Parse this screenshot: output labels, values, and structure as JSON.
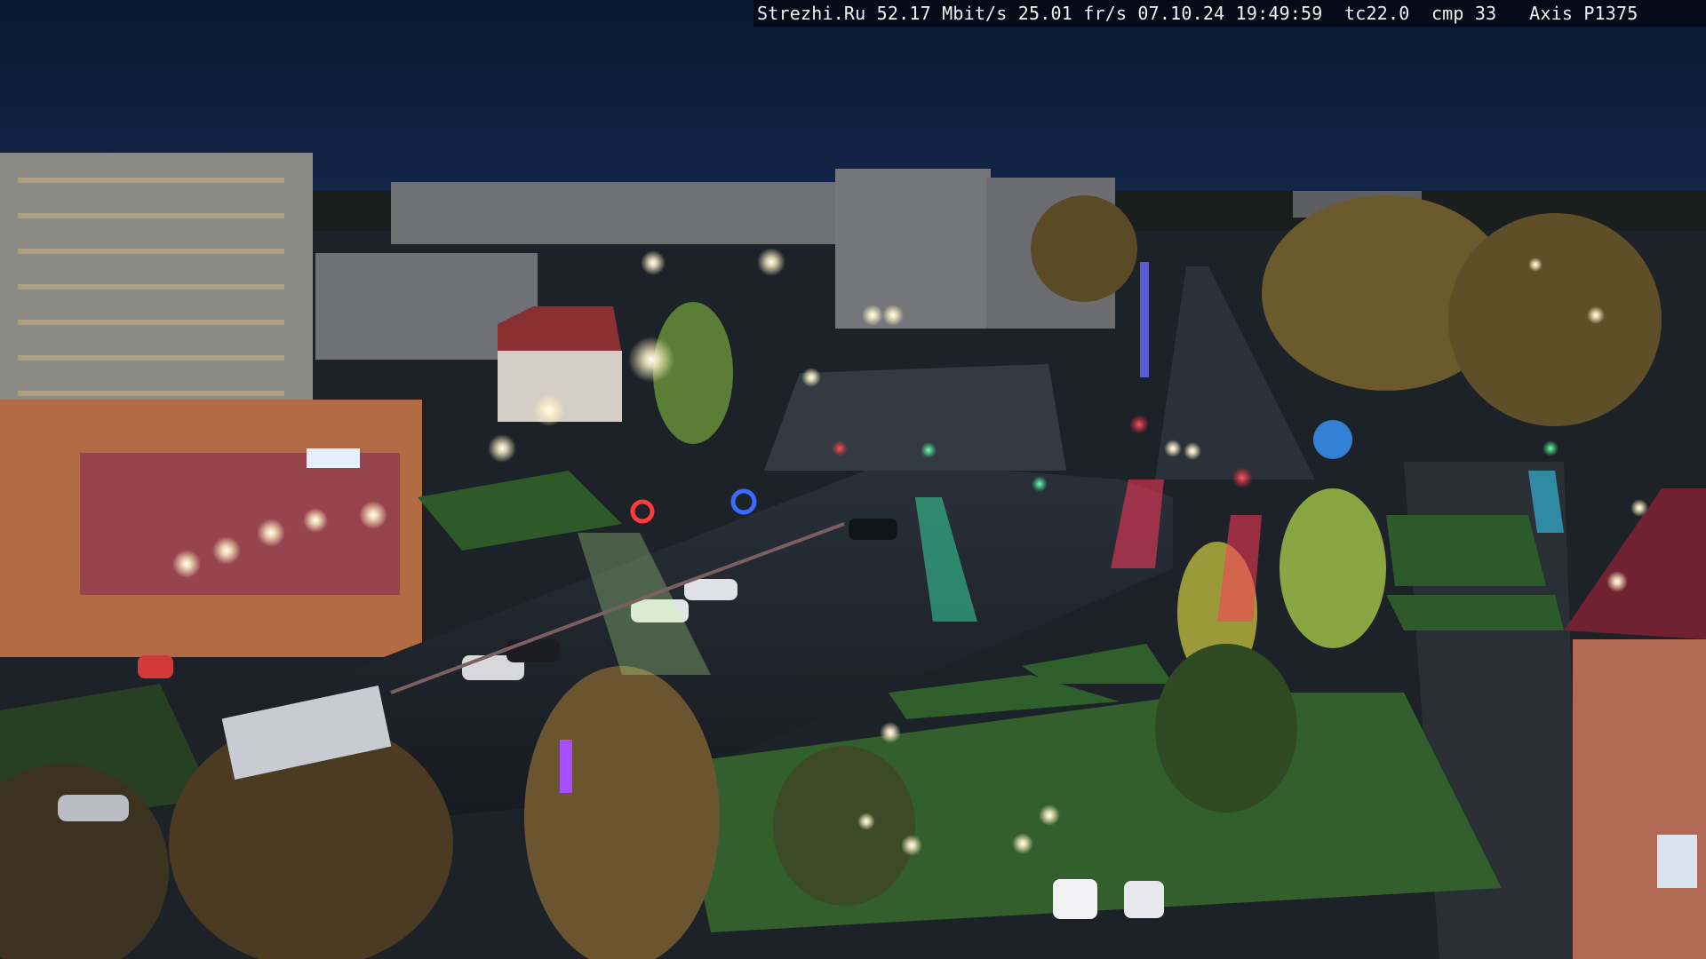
{
  "image": {
    "subject": "night-time elevated webcam view of a wet city intersection",
    "colors": {
      "sky": "#0b1a33",
      "sky_top": "#0a1730",
      "asphalt": "#1c2229",
      "grass": "#2e5a2a",
      "building": "#7a7a78",
      "street_light": "#fff6d8",
      "signal_red": "#ff2a3c",
      "signal_green": "#36ff8a"
    }
  },
  "overlay": {
    "text": "Strezhi.Ru 52.17 Mbit/s 25.01 fr/s 07.10.24 19:49:59  tc22.0  cmp 33   Axis P1375"
  }
}
